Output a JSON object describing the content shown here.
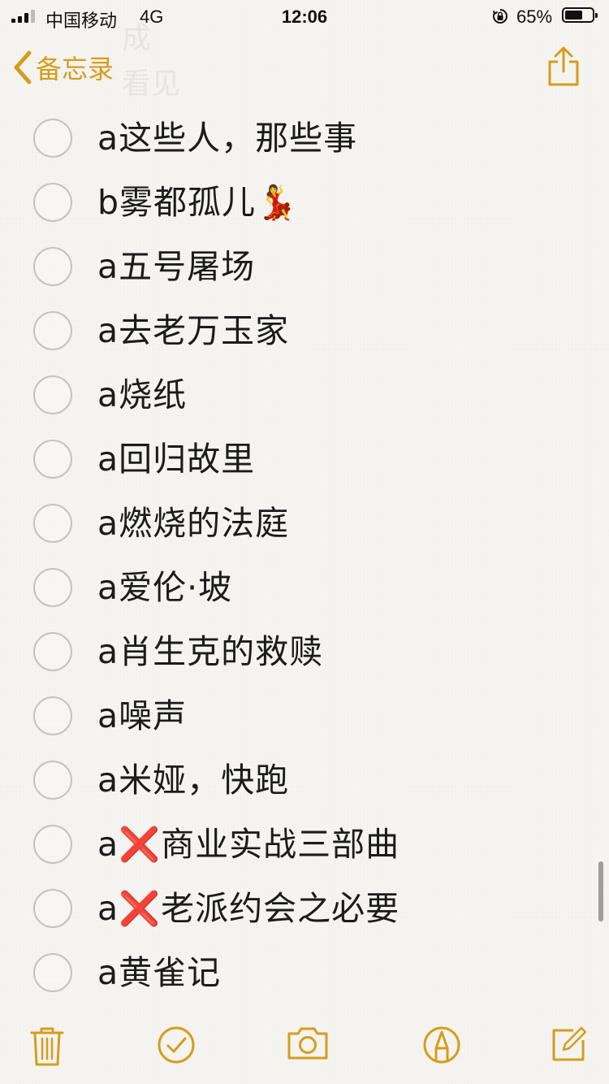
{
  "status_bar": {
    "carrier": "中国移动",
    "network": "4G",
    "time": "12:06",
    "battery": "65%",
    "battery_level": 0.65
  },
  "nav": {
    "back_label": "备忘录",
    "ghost_lines": [
      "成",
      "看见"
    ]
  },
  "checklist": [
    "a这些人，那些事",
    "b雾都孤儿💃",
    "a五号屠场",
    "a去老万玉家",
    "a烧纸",
    "a回归故里",
    "a燃烧的法庭",
    "a爱伦·坡",
    "a肖生克的救赎",
    "a噪声",
    "a米娅，快跑",
    "a❌商业实战三部曲",
    "a❌老派约会之必要",
    "a黄雀记"
  ],
  "colors": {
    "accent": "#d69d1c",
    "checkbox_border": "#c3c3c3"
  },
  "toolbar": {
    "icons": [
      "trash-icon",
      "checklist-icon",
      "camera-icon",
      "markup-icon",
      "compose-icon"
    ]
  }
}
